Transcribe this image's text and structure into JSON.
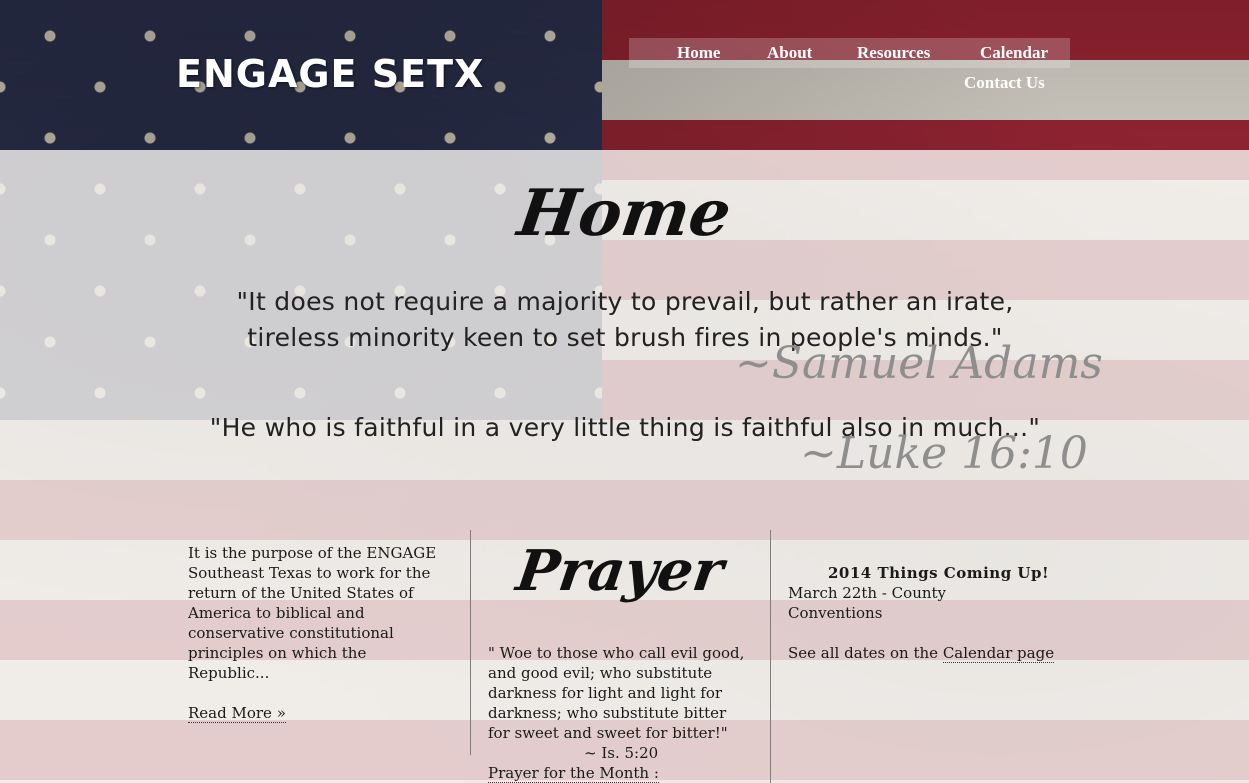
{
  "site": {
    "title": "ENGAGE SETX"
  },
  "nav": {
    "items": [
      {
        "label": "Home"
      },
      {
        "label": "About"
      },
      {
        "label": "Resources"
      },
      {
        "label": "Calendar"
      },
      {
        "label": "Contact Us"
      }
    ]
  },
  "page": {
    "title": "Home"
  },
  "quotes": [
    {
      "line1": "\"It does not require a majority to prevail, but rather an irate,",
      "line2": "tireless minority keen to set brush fires in people's minds.\"",
      "attribution": "~Samuel Adams"
    },
    {
      "line1": "\"He who is faithful in a very little thing is faithful also in much...\"",
      "attribution": "~Luke 16:10"
    }
  ],
  "purpose": {
    "lines": [
      "It is the purpose of the ENGAGE",
      "Southeast Texas to work for the",
      "return of the United States of",
      "America to biblical and",
      "conservative constitutional",
      "principles on which the",
      "Republic..."
    ],
    "read_more": "Read More »"
  },
  "prayer": {
    "title": "Prayer",
    "lines": [
      "\" Woe to those who call evil good,",
      "and good evil; who substitute",
      "darkness for light and light for",
      "darkness; who substitute bitter",
      "for sweet and sweet for bitter!\""
    ],
    "reference": "~ Is. 5:20",
    "month_label": "Prayer for the Month :"
  },
  "events": {
    "heading": "2014 Things Coming Up!",
    "item_line1": "March 22th - County",
    "item_line2": "Conventions",
    "see_all_prefix": "See all dates on the ",
    "calendar_link": "Calendar page"
  }
}
